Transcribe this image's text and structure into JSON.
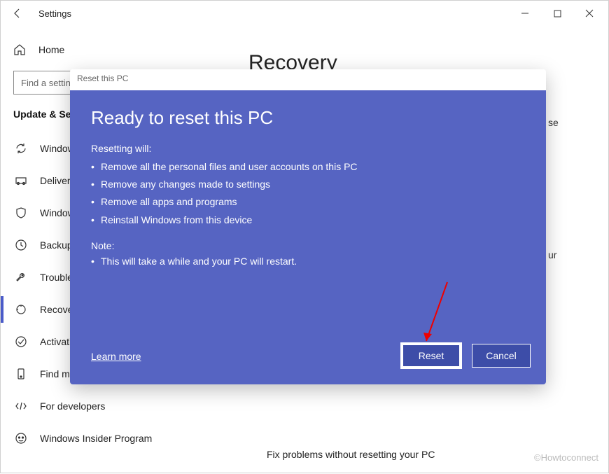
{
  "window": {
    "title": "Settings",
    "controls": {
      "min": "–",
      "max": "▢",
      "close": "✕"
    }
  },
  "sidebar": {
    "home": "Home",
    "search_placeholder": "Find a setting",
    "section": "Update & Security",
    "items": [
      {
        "icon": "sync",
        "label": "Windows Update"
      },
      {
        "icon": "delivery",
        "label": "Delivery Optimization"
      },
      {
        "icon": "shield",
        "label": "Windows Security"
      },
      {
        "icon": "backup",
        "label": "Backup"
      },
      {
        "icon": "wrench",
        "label": "Troubleshoot"
      },
      {
        "icon": "recovery",
        "label": "Recovery"
      },
      {
        "icon": "check",
        "label": "Activation"
      },
      {
        "icon": "find",
        "label": "Find my device"
      },
      {
        "icon": "dev",
        "label": "For developers"
      },
      {
        "icon": "insider",
        "label": "Windows Insider Program"
      }
    ],
    "selected_index": 5
  },
  "main": {
    "heading": "Recovery",
    "hidden_line1_tail": "se",
    "hidden_line2_tail": "ur",
    "footer_heading": "Fix problems without resetting your PC"
  },
  "modal": {
    "frame_title": "Reset this PC",
    "heading": "Ready to reset this PC",
    "lead": "Resetting will:",
    "bullets": [
      "Remove all the personal files and user accounts on this PC",
      "Remove any changes made to settings",
      "Remove all apps and programs",
      "Reinstall Windows from this device"
    ],
    "note_label": "Note:",
    "note_bullets": [
      "This will take a while and your PC will restart."
    ],
    "learn_more": "Learn more",
    "btn_reset": "Reset",
    "btn_cancel": "Cancel"
  },
  "watermark": "©Howtoconnect"
}
